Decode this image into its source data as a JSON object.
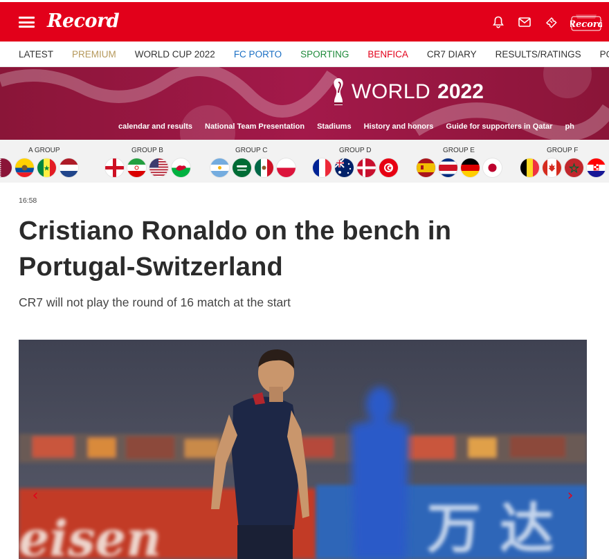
{
  "header": {
    "logo": "Record",
    "mini_logo": "Record",
    "icons": [
      "menu-icon",
      "bell-icon",
      "mail-icon",
      "ticket-icon"
    ]
  },
  "nav": {
    "items": [
      {
        "label": "LATEST",
        "color": "#333333"
      },
      {
        "label": "PREMIUM",
        "color": "#b5985a"
      },
      {
        "label": "WORLD CUP 2022",
        "color": "#333333"
      },
      {
        "label": "FC PORTO",
        "color": "#1a6fc4"
      },
      {
        "label": "SPORTING",
        "color": "#1e8a3a"
      },
      {
        "label": "BENFICA",
        "color": "#e2001a"
      },
      {
        "label": "CR7 DIARY",
        "color": "#333333"
      },
      {
        "label": "RESULTS/RATINGS",
        "color": "#333333"
      },
      {
        "label": "PODCAST R",
        "color": "#333333"
      }
    ]
  },
  "banner": {
    "word": "WORLD",
    "year": "2022",
    "links": [
      "calendar and results",
      "National Team Presentation",
      "Stadiums",
      "History and honors",
      "Guide for supporters in Qatar",
      "ph"
    ]
  },
  "groups": [
    {
      "label": "A GROUP",
      "flags": [
        "qatar",
        "ecuador",
        "senegal",
        "netherlands"
      ]
    },
    {
      "label": "GROUP B",
      "flags": [
        "england",
        "iran",
        "usa",
        "wales"
      ]
    },
    {
      "label": "GROUP C",
      "flags": [
        "argentina",
        "saudi-arabia",
        "mexico",
        "poland"
      ]
    },
    {
      "label": "GROUP D",
      "flags": [
        "france",
        "australia",
        "denmark",
        "tunisia"
      ]
    },
    {
      "label": "GROUP E",
      "flags": [
        "spain",
        "costa-rica",
        "germany",
        "japan"
      ]
    },
    {
      "label": "GROUP F",
      "flags": [
        "belgium",
        "canada",
        "morocco",
        "croatia"
      ]
    }
  ],
  "article": {
    "time": "16:58",
    "headline": "Cristiano Ronaldo on the bench in Portugal-Switzerland",
    "subtitle": "CR7 will not play the round of 16 match at the start",
    "photo_text": "eisen"
  },
  "colors": {
    "brand_red": "#e2001a",
    "banner_maroon": "#8a1538"
  }
}
